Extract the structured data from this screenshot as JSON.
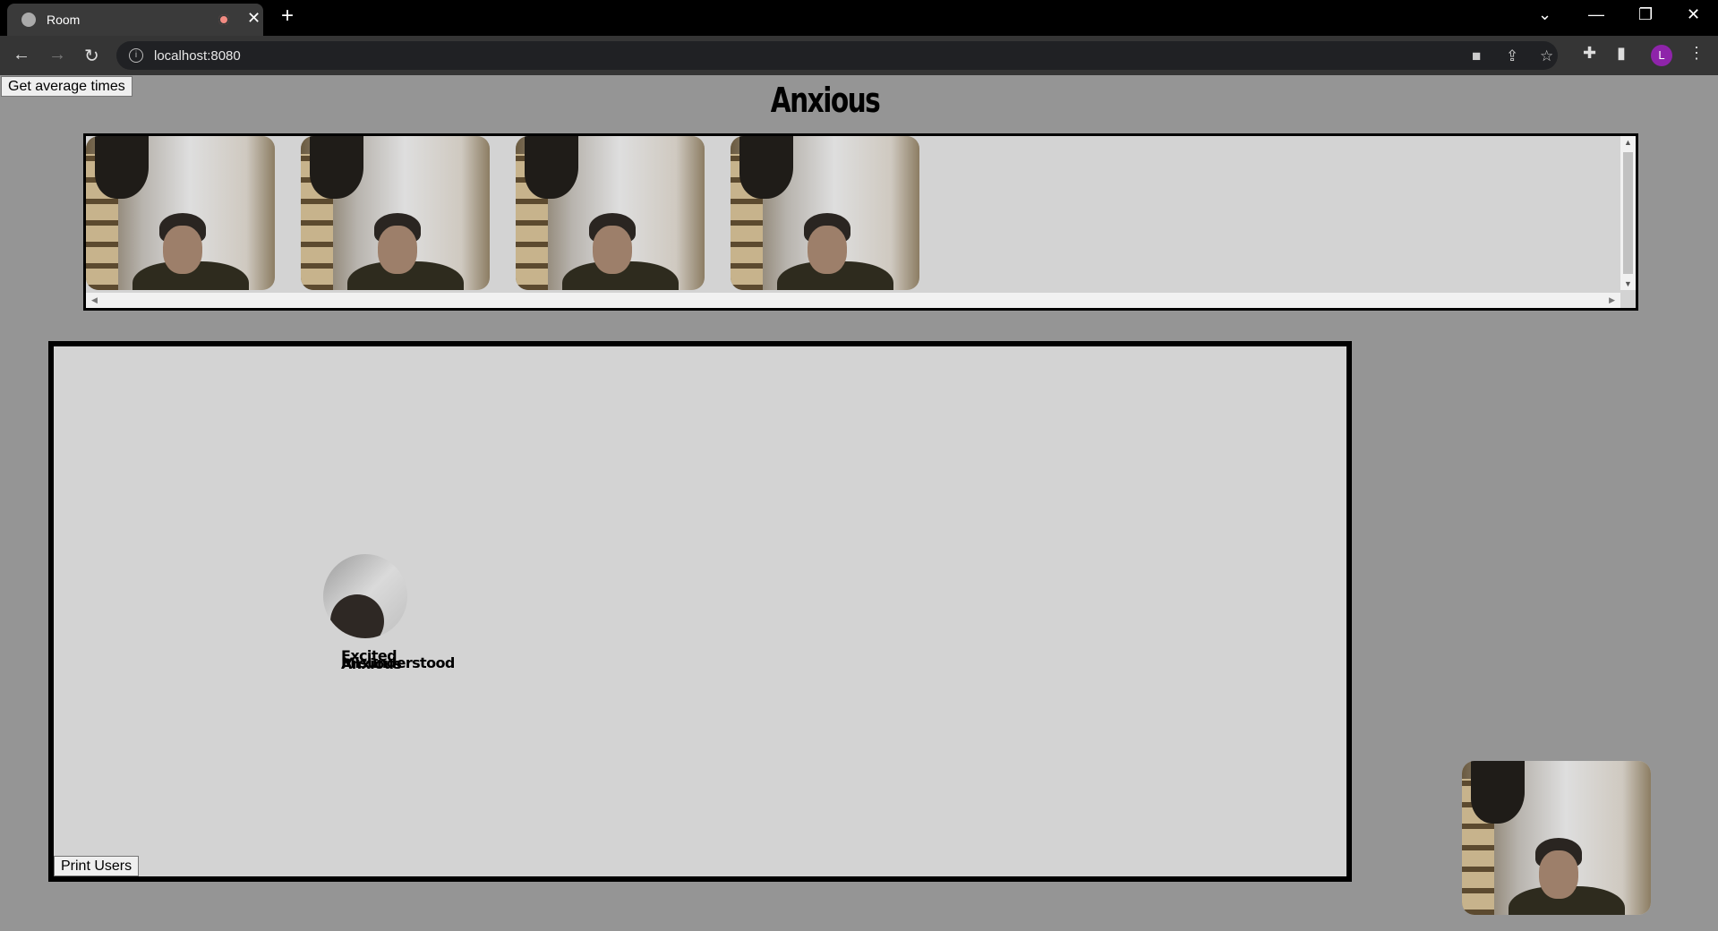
{
  "browser": {
    "tab_title": "Room",
    "url": "localhost:8080",
    "profile_initial": "L"
  },
  "page": {
    "average_button_label": "Get average times",
    "current_mood": "Anxious",
    "print_button_label": "Print Users",
    "emotion_labels": [
      "Excited",
      "Anxious",
      "Misunderstood"
    ]
  }
}
